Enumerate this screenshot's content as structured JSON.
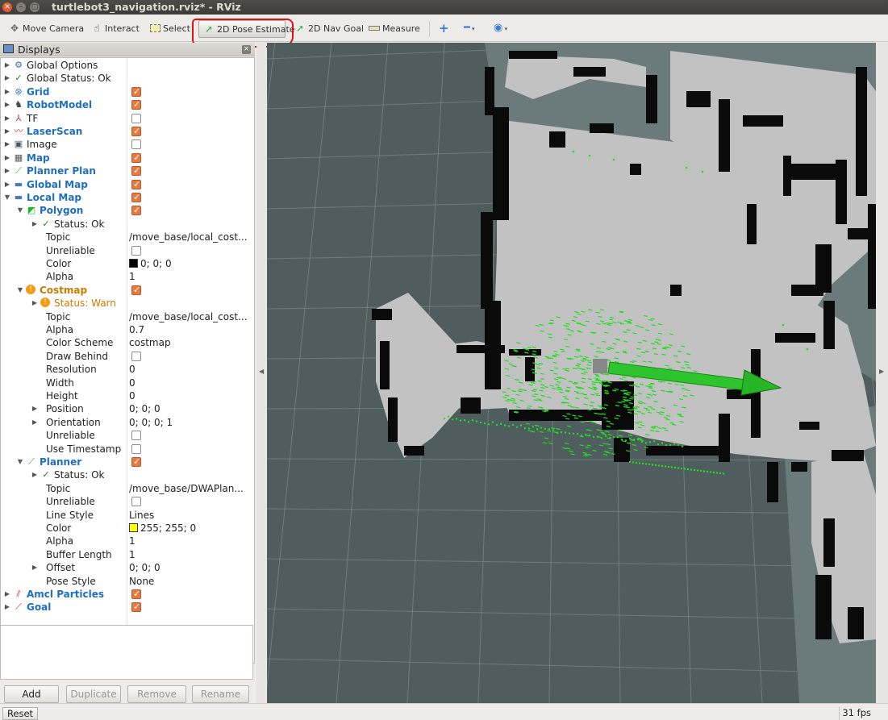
{
  "window": {
    "title": "turtlebot3_navigation.rviz* - RViz",
    "controls": [
      "close-icon",
      "minimize-icon",
      "maximize-icon"
    ]
  },
  "toolbar": {
    "move_camera": "Move Camera",
    "interact": "Interact",
    "select": "Select",
    "pose_estimate": "2D Pose Estimate",
    "nav_goal": "2D Nav Goal",
    "measure": "Measure",
    "active_tool": "2D Pose Estimate"
  },
  "displays_panel": {
    "title": "Displays",
    "rows": [
      {
        "indent": 0,
        "arrow": "right",
        "icon": "gear-icon",
        "name": "Global Options"
      },
      {
        "indent": 0,
        "arrow": "right",
        "icon": "check-icon",
        "name": "Global Status: Ok"
      },
      {
        "indent": 0,
        "arrow": "right",
        "icon": "grid-icon",
        "name": "Grid",
        "style": "blue",
        "checked": true
      },
      {
        "indent": 0,
        "arrow": "right",
        "icon": "robot-model-icon",
        "name": "RobotModel",
        "style": "blue",
        "checked": true
      },
      {
        "indent": 0,
        "arrow": "right",
        "icon": "axes-icon",
        "name": "TF",
        "checked": false
      },
      {
        "indent": 0,
        "arrow": "right",
        "icon": "laser-scan-icon",
        "name": "LaserScan",
        "style": "blue",
        "checked": true
      },
      {
        "indent": 0,
        "arrow": "right",
        "icon": "image-icon",
        "name": "Image",
        "checked": false
      },
      {
        "indent": 0,
        "arrow": "right",
        "icon": "map-icon",
        "name": "Map",
        "style": "blue",
        "checked": true
      },
      {
        "indent": 0,
        "arrow": "right",
        "icon": "path-icon",
        "name": "Planner Plan",
        "style": "blue",
        "checked": true
      },
      {
        "indent": 0,
        "arrow": "right",
        "icon": "folder-icon",
        "name": "Global Map",
        "style": "blue",
        "checked": true
      },
      {
        "indent": 0,
        "arrow": "down",
        "icon": "folder-icon",
        "name": "Local Map",
        "style": "blue",
        "checked": true
      },
      {
        "indent": 1,
        "arrow": "down",
        "icon": "polygon-icon",
        "name": "Polygon",
        "style": "blue",
        "checked": true
      },
      {
        "indent": 2,
        "arrow": "right",
        "icon": "check-icon",
        "name": "Status: Ok"
      },
      {
        "indent": 2,
        "name": "Topic",
        "value": "/move_base/local_cost..."
      },
      {
        "indent": 2,
        "name": "Unreliable",
        "checked": false
      },
      {
        "indent": 2,
        "name": "Color",
        "value": "0; 0; 0",
        "swatch": "#000000"
      },
      {
        "indent": 2,
        "name": "Alpha",
        "value": "1"
      },
      {
        "indent": 1,
        "arrow": "down",
        "icon": "warning-icon",
        "name": "Costmap",
        "style": "orange",
        "checked": true
      },
      {
        "indent": 2,
        "arrow": "right",
        "icon": "warning-icon",
        "name": "Status: Warn",
        "style": "orange-plain"
      },
      {
        "indent": 2,
        "name": "Topic",
        "value": "/move_base/local_cost..."
      },
      {
        "indent": 2,
        "name": "Alpha",
        "value": "0.7"
      },
      {
        "indent": 2,
        "name": "Color Scheme",
        "value": "costmap"
      },
      {
        "indent": 2,
        "name": "Draw Behind",
        "checked": false
      },
      {
        "indent": 2,
        "name": "Resolution",
        "value": "0"
      },
      {
        "indent": 2,
        "name": "Width",
        "value": "0"
      },
      {
        "indent": 2,
        "name": "Height",
        "value": "0"
      },
      {
        "indent": 2,
        "arrow": "right",
        "name": "Position",
        "value": "0; 0; 0"
      },
      {
        "indent": 2,
        "arrow": "right",
        "name": "Orientation",
        "value": "0; 0; 0; 1"
      },
      {
        "indent": 2,
        "name": "Unreliable",
        "checked": false
      },
      {
        "indent": 2,
        "name": "Use Timestamp",
        "checked": false
      },
      {
        "indent": 1,
        "arrow": "down",
        "icon": "path-icon",
        "name": "Planner",
        "style": "blue",
        "checked": true
      },
      {
        "indent": 2,
        "arrow": "right",
        "icon": "check-icon",
        "name": "Status: Ok"
      },
      {
        "indent": 2,
        "name": "Topic",
        "value": "/move_base/DWAPlan..."
      },
      {
        "indent": 2,
        "name": "Unreliable",
        "checked": false
      },
      {
        "indent": 2,
        "name": "Line Style",
        "value": "Lines"
      },
      {
        "indent": 2,
        "name": "Color",
        "value": "255; 255; 0",
        "swatch": "#ffff00"
      },
      {
        "indent": 2,
        "name": "Alpha",
        "value": "1"
      },
      {
        "indent": 2,
        "name": "Buffer Length",
        "value": "1"
      },
      {
        "indent": 2,
        "arrow": "right",
        "name": "Offset",
        "value": "0; 0; 0"
      },
      {
        "indent": 2,
        "name": "Pose Style",
        "value": "None"
      },
      {
        "indent": 0,
        "arrow": "right",
        "icon": "particles-icon",
        "name": "Amcl Particles",
        "style": "blue",
        "checked": true
      },
      {
        "indent": 0,
        "arrow": "right",
        "icon": "goal-icon",
        "name": "Goal",
        "style": "blue",
        "checked": true
      }
    ],
    "buttons": {
      "add": "Add",
      "duplicate": "Duplicate",
      "remove": "Remove",
      "rename": "Rename"
    }
  },
  "statusbar": {
    "reset": "Reset",
    "fps": "31 fps"
  },
  "colors": {
    "viewport_bg": "#4f5d5e",
    "map_free": "#c2c2c2",
    "map_unknown": "#6b7a7b",
    "obstacle": "#0a0a0a",
    "particles": "#22dd22",
    "pose_arrow": "#2ec42e",
    "highlight": "#e01010",
    "checkbox_on": "#e9793f"
  }
}
